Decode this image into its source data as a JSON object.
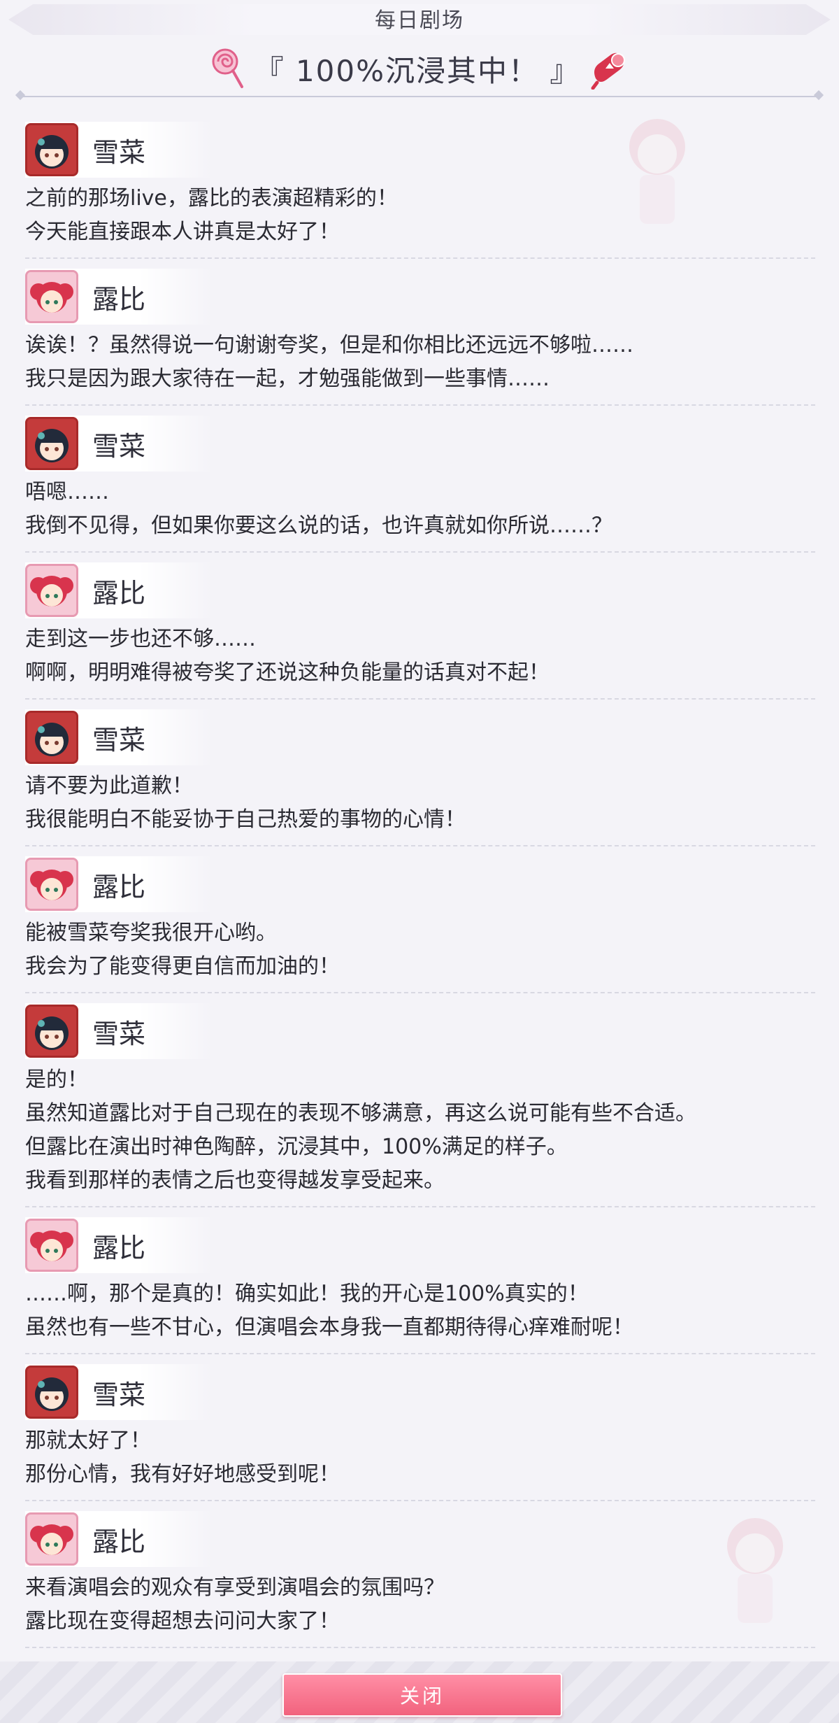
{
  "header": {
    "section_label": "每日剧场",
    "title": "『 100%沉浸其中！ 』",
    "left_icon": "lollipop-icon",
    "right_icon": "microphone-icon"
  },
  "dialogue": [
    {
      "speaker": "雪菜",
      "avatar": "setsuna",
      "lines": [
        "之前的那场live，露比的表演超精彩的！",
        "今天能直接跟本人讲真是太好了！"
      ]
    },
    {
      "speaker": "露比",
      "avatar": "ruby",
      "lines": [
        "诶诶！？虽然得说一句谢谢夸奖，但是和你相比还远远不够啦……",
        "我只是因为跟大家待在一起，才勉强能做到一些事情……"
      ]
    },
    {
      "speaker": "雪菜",
      "avatar": "setsuna",
      "lines": [
        "唔嗯……",
        "我倒不见得，但如果你要这么说的话，也许真就如你所说……？"
      ]
    },
    {
      "speaker": "露比",
      "avatar": "ruby",
      "lines": [
        "走到这一步也还不够……",
        "啊啊，明明难得被夸奖了还说这种负能量的话真对不起！"
      ]
    },
    {
      "speaker": "雪菜",
      "avatar": "setsuna",
      "lines": [
        "请不要为此道歉！",
        "我很能明白不能妥协于自己热爱的事物的心情！"
      ]
    },
    {
      "speaker": "露比",
      "avatar": "ruby",
      "lines": [
        "能被雪菜夸奖我很开心哟。",
        "我会为了能变得更自信而加油的！"
      ]
    },
    {
      "speaker": "雪菜",
      "avatar": "setsuna",
      "lines": [
        "是的！",
        "虽然知道露比对于自己现在的表现不够满意，再这么说可能有些不合适。",
        "但露比在演出时神色陶醉，沉浸其中，100%满足的样子。",
        "我看到那样的表情之后也变得越发享受起来。"
      ]
    },
    {
      "speaker": "露比",
      "avatar": "ruby",
      "lines": [
        "……啊，那个是真的！确实如此！我的开心是100%真实的！",
        "虽然也有一些不甘心，但演唱会本身我一直都期待得心痒难耐呢！"
      ]
    },
    {
      "speaker": "雪菜",
      "avatar": "setsuna",
      "lines": [
        "那就太好了！",
        "那份心情，我有好好地感受到呢！"
      ]
    },
    {
      "speaker": "露比",
      "avatar": "ruby",
      "lines": [
        "来看演唱会的观众有享受到演唱会的氛围吗？",
        "露比现在变得超想去问问大家了！"
      ]
    }
  ],
  "footer": {
    "close_label": "关闭"
  },
  "colors": {
    "accent": "#f2627d",
    "setsuna": "#c43b3b",
    "ruby": "#e79ab2"
  }
}
